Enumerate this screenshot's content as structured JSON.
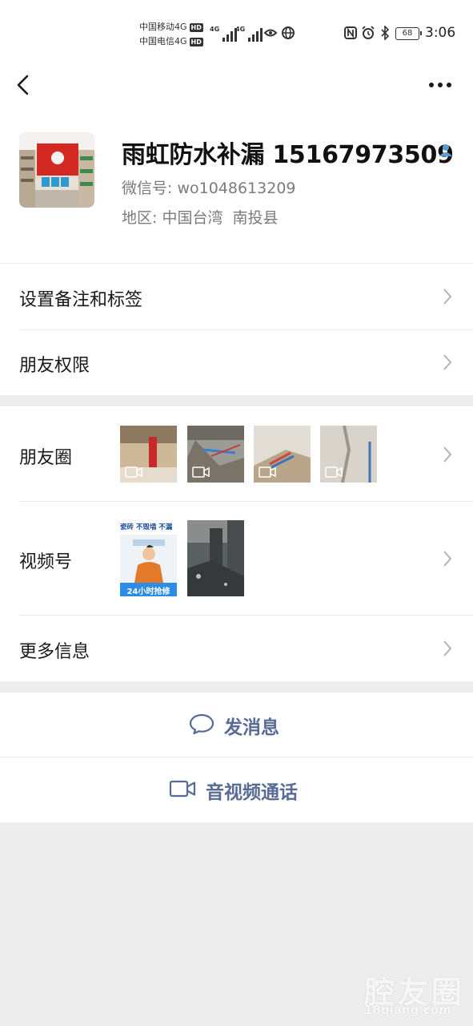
{
  "status_bar": {
    "carrier1": "中国移动4G",
    "carrier2": "中国电信4G",
    "hd": "HD",
    "net": "4G",
    "battery": "68",
    "time": "3:06"
  },
  "profile": {
    "name": "雨虹防水补漏 15167973509",
    "wechat_label": "微信号:",
    "wechat_id": "wo1048613209",
    "region_label": "地区:",
    "region": "中国台湾  南投县"
  },
  "menu": {
    "remarks": "设置备注和标签",
    "permissions": "朋友权限",
    "moments": "朋友圈",
    "channels": "视频号",
    "more_info": "更多信息"
  },
  "channel_thumb_text": {
    "top": "瓷砖  不毁墙  不漏",
    "bottom": "24小时抢修"
  },
  "actions": {
    "message": "发消息",
    "call": "音视频通话"
  },
  "watermark": {
    "line1": "腔友圈",
    "line2": "18qiang.com"
  },
  "colors": {
    "link": "#576b95",
    "page_bg": "#ededed",
    "card_bg": "#ffffff"
  }
}
